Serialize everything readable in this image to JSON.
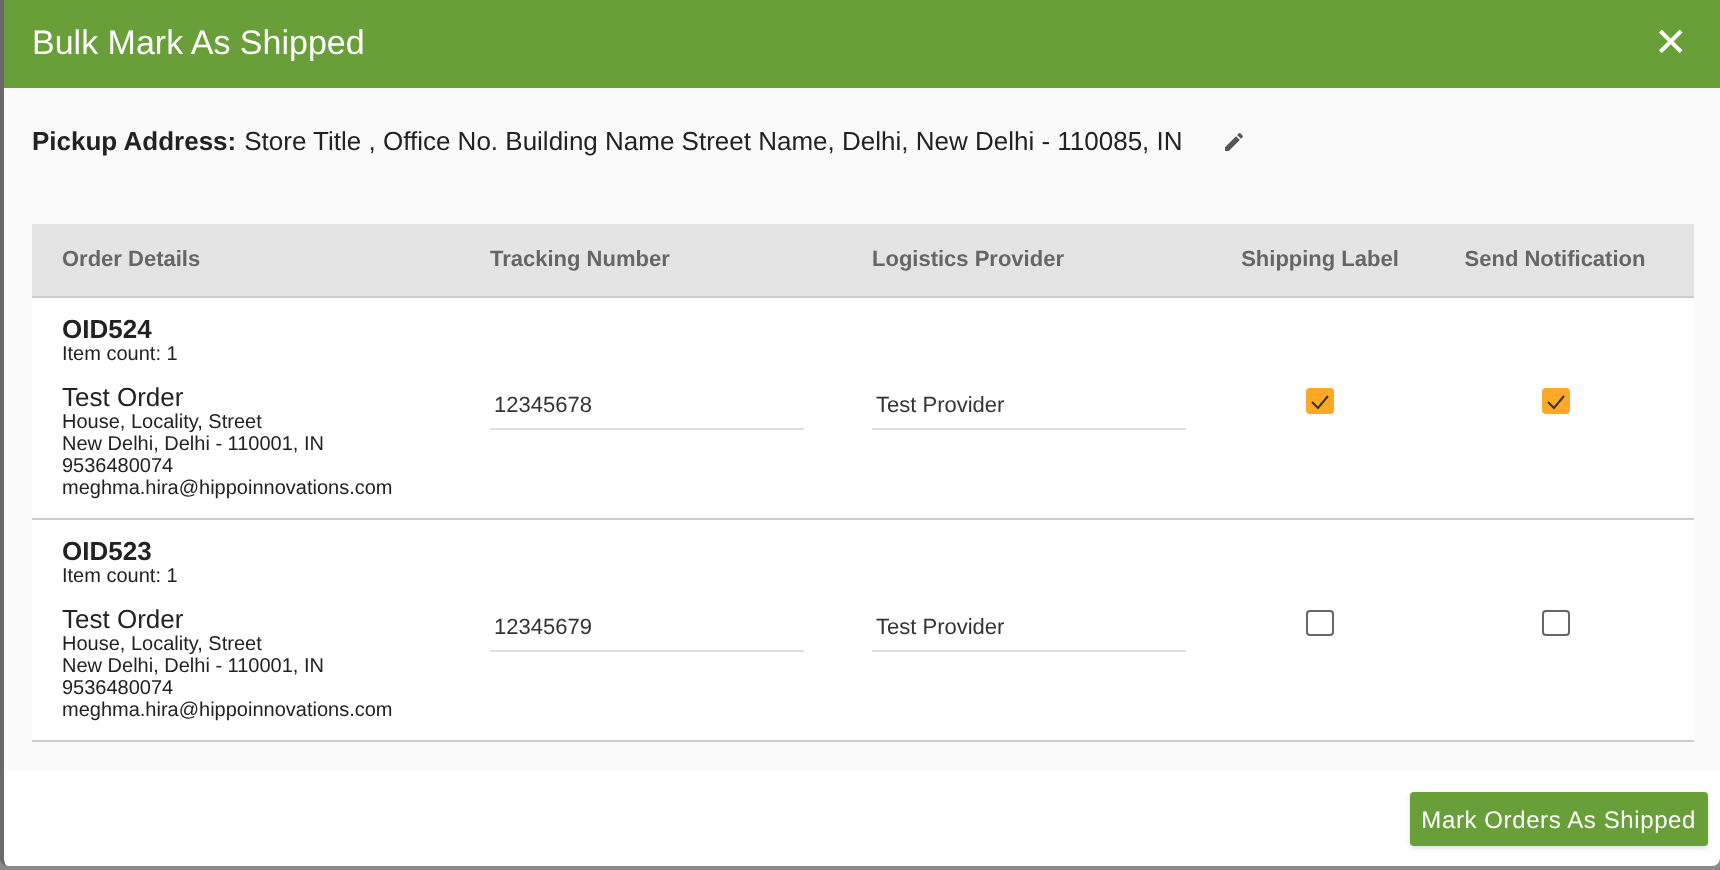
{
  "dialog": {
    "title": "Bulk Mark As Shipped",
    "close": "✕"
  },
  "pickup": {
    "label": "Pickup Address:",
    "address": "Store Title , Office No. Building Name Street Name, Delhi, New Delhi - 110085, IN"
  },
  "table": {
    "columns": [
      "Order Details",
      "Tracking Number",
      "Logistics Provider",
      "Shipping Label",
      "Send Notification"
    ],
    "rows": [
      {
        "order_id": "OID524",
        "item_count": "Item count: 1",
        "name": "Test Order",
        "address_lines": [
          "House, Locality, Street",
          "New Delhi, Delhi - 110001, IN",
          "9536480074",
          "meghma.hira@hippoinnovations.com"
        ],
        "tracking_number": "12345678",
        "provider": "Test Provider",
        "shipping_label": true,
        "send_notification": true
      },
      {
        "order_id": "OID523",
        "item_count": "Item count: 1",
        "name": "Test Order",
        "address_lines": [
          "House, Locality, Street",
          "New Delhi, Delhi - 110001, IN",
          "9536480074",
          "meghma.hira@hippoinnovations.com"
        ],
        "tracking_number": "12345679",
        "provider": "Test Provider",
        "shipping_label": false,
        "send_notification": false
      }
    ]
  },
  "buttons": [
    "Mark Orders As Shipped"
  ]
}
